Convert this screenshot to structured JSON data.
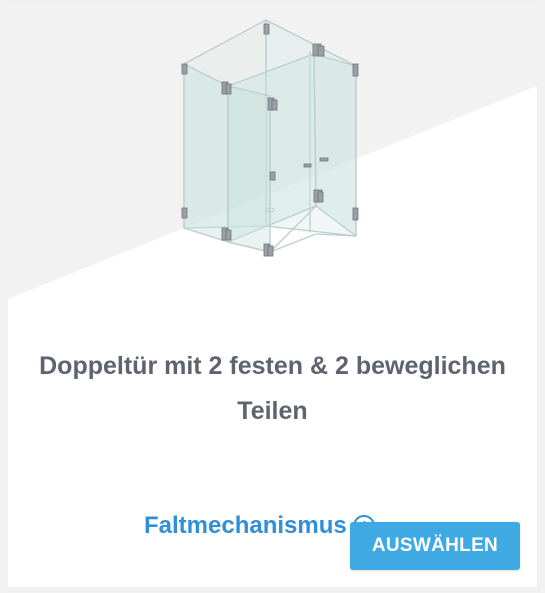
{
  "product": {
    "title": "Doppeltür mit 2 festen & 2 beweglichen Teilen",
    "mechanism": "Faltmechanismus",
    "info_icon": "info-icon",
    "select_label": "AUSWÄHLEN"
  },
  "colors": {
    "title": "#5d6470",
    "mechanism": "#2f8fd9",
    "button": "#3fa9e3",
    "background": "#f1f1f2"
  }
}
